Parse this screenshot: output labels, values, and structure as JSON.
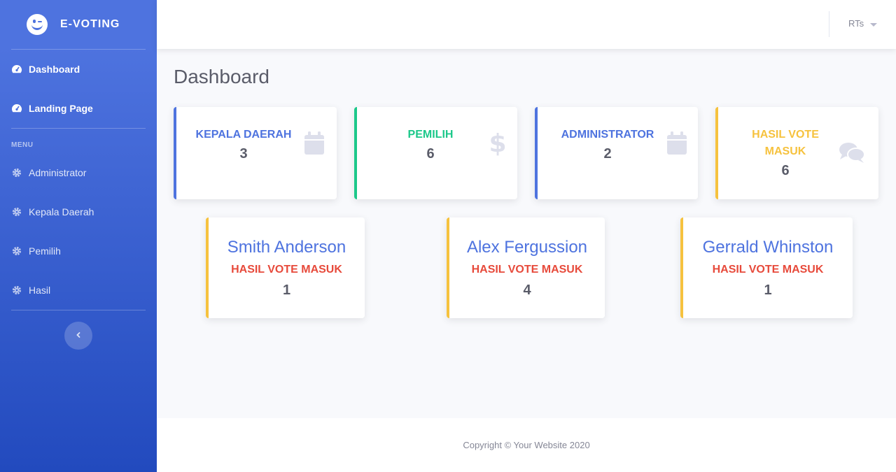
{
  "brand": {
    "title": "E-VOTING",
    "icon": "laugh-wink-icon"
  },
  "sidebar": {
    "items_top": [
      {
        "label": "Dashboard",
        "icon": "tachometer-icon"
      },
      {
        "label": "Landing Page",
        "icon": "tachometer-icon"
      }
    ],
    "heading": "MENU",
    "items_menu": [
      {
        "label": "Administrator",
        "icon": "cog-icon"
      },
      {
        "label": "Kepala Daerah",
        "icon": "cog-icon"
      },
      {
        "label": "Pemilih",
        "icon": "cog-icon"
      },
      {
        "label": "Hasil",
        "icon": "cog-icon"
      }
    ],
    "toggle_icon": "chevron-left-icon"
  },
  "topbar": {
    "user": "RTs"
  },
  "page": {
    "title": "Dashboard"
  },
  "stats": [
    {
      "label": "KEPALA DAERAH",
      "value": "3",
      "color": "#4e73df",
      "icon": "calendar-icon"
    },
    {
      "label": "PEMILIH",
      "value": "6",
      "color": "#1cc88a",
      "icon": "dollar-icon"
    },
    {
      "label": "ADMINISTRATOR",
      "value": "2",
      "color": "#4e73df",
      "icon": "calendar-icon"
    },
    {
      "label": "HASIL VOTE MASUK",
      "value": "6",
      "color": "#f6c23e",
      "icon": "comments-icon"
    }
  ],
  "candidates": [
    {
      "name": "Smith Anderson",
      "label": "HASIL VOTE MASUK",
      "value": "1"
    },
    {
      "name": "Alex Fergussion",
      "label": "HASIL VOTE MASUK",
      "value": "4"
    },
    {
      "name": "Gerrald Whinston",
      "label": "HASIL VOTE MASUK",
      "value": "1"
    }
  ],
  "colors": {
    "primary": "#4e73df",
    "success": "#1cc88a",
    "warning": "#f6c23e",
    "danger": "#e74a3b",
    "icon_gray": "#dddfeb"
  },
  "footer": {
    "copyright": "Copyright © Your Website 2020"
  }
}
